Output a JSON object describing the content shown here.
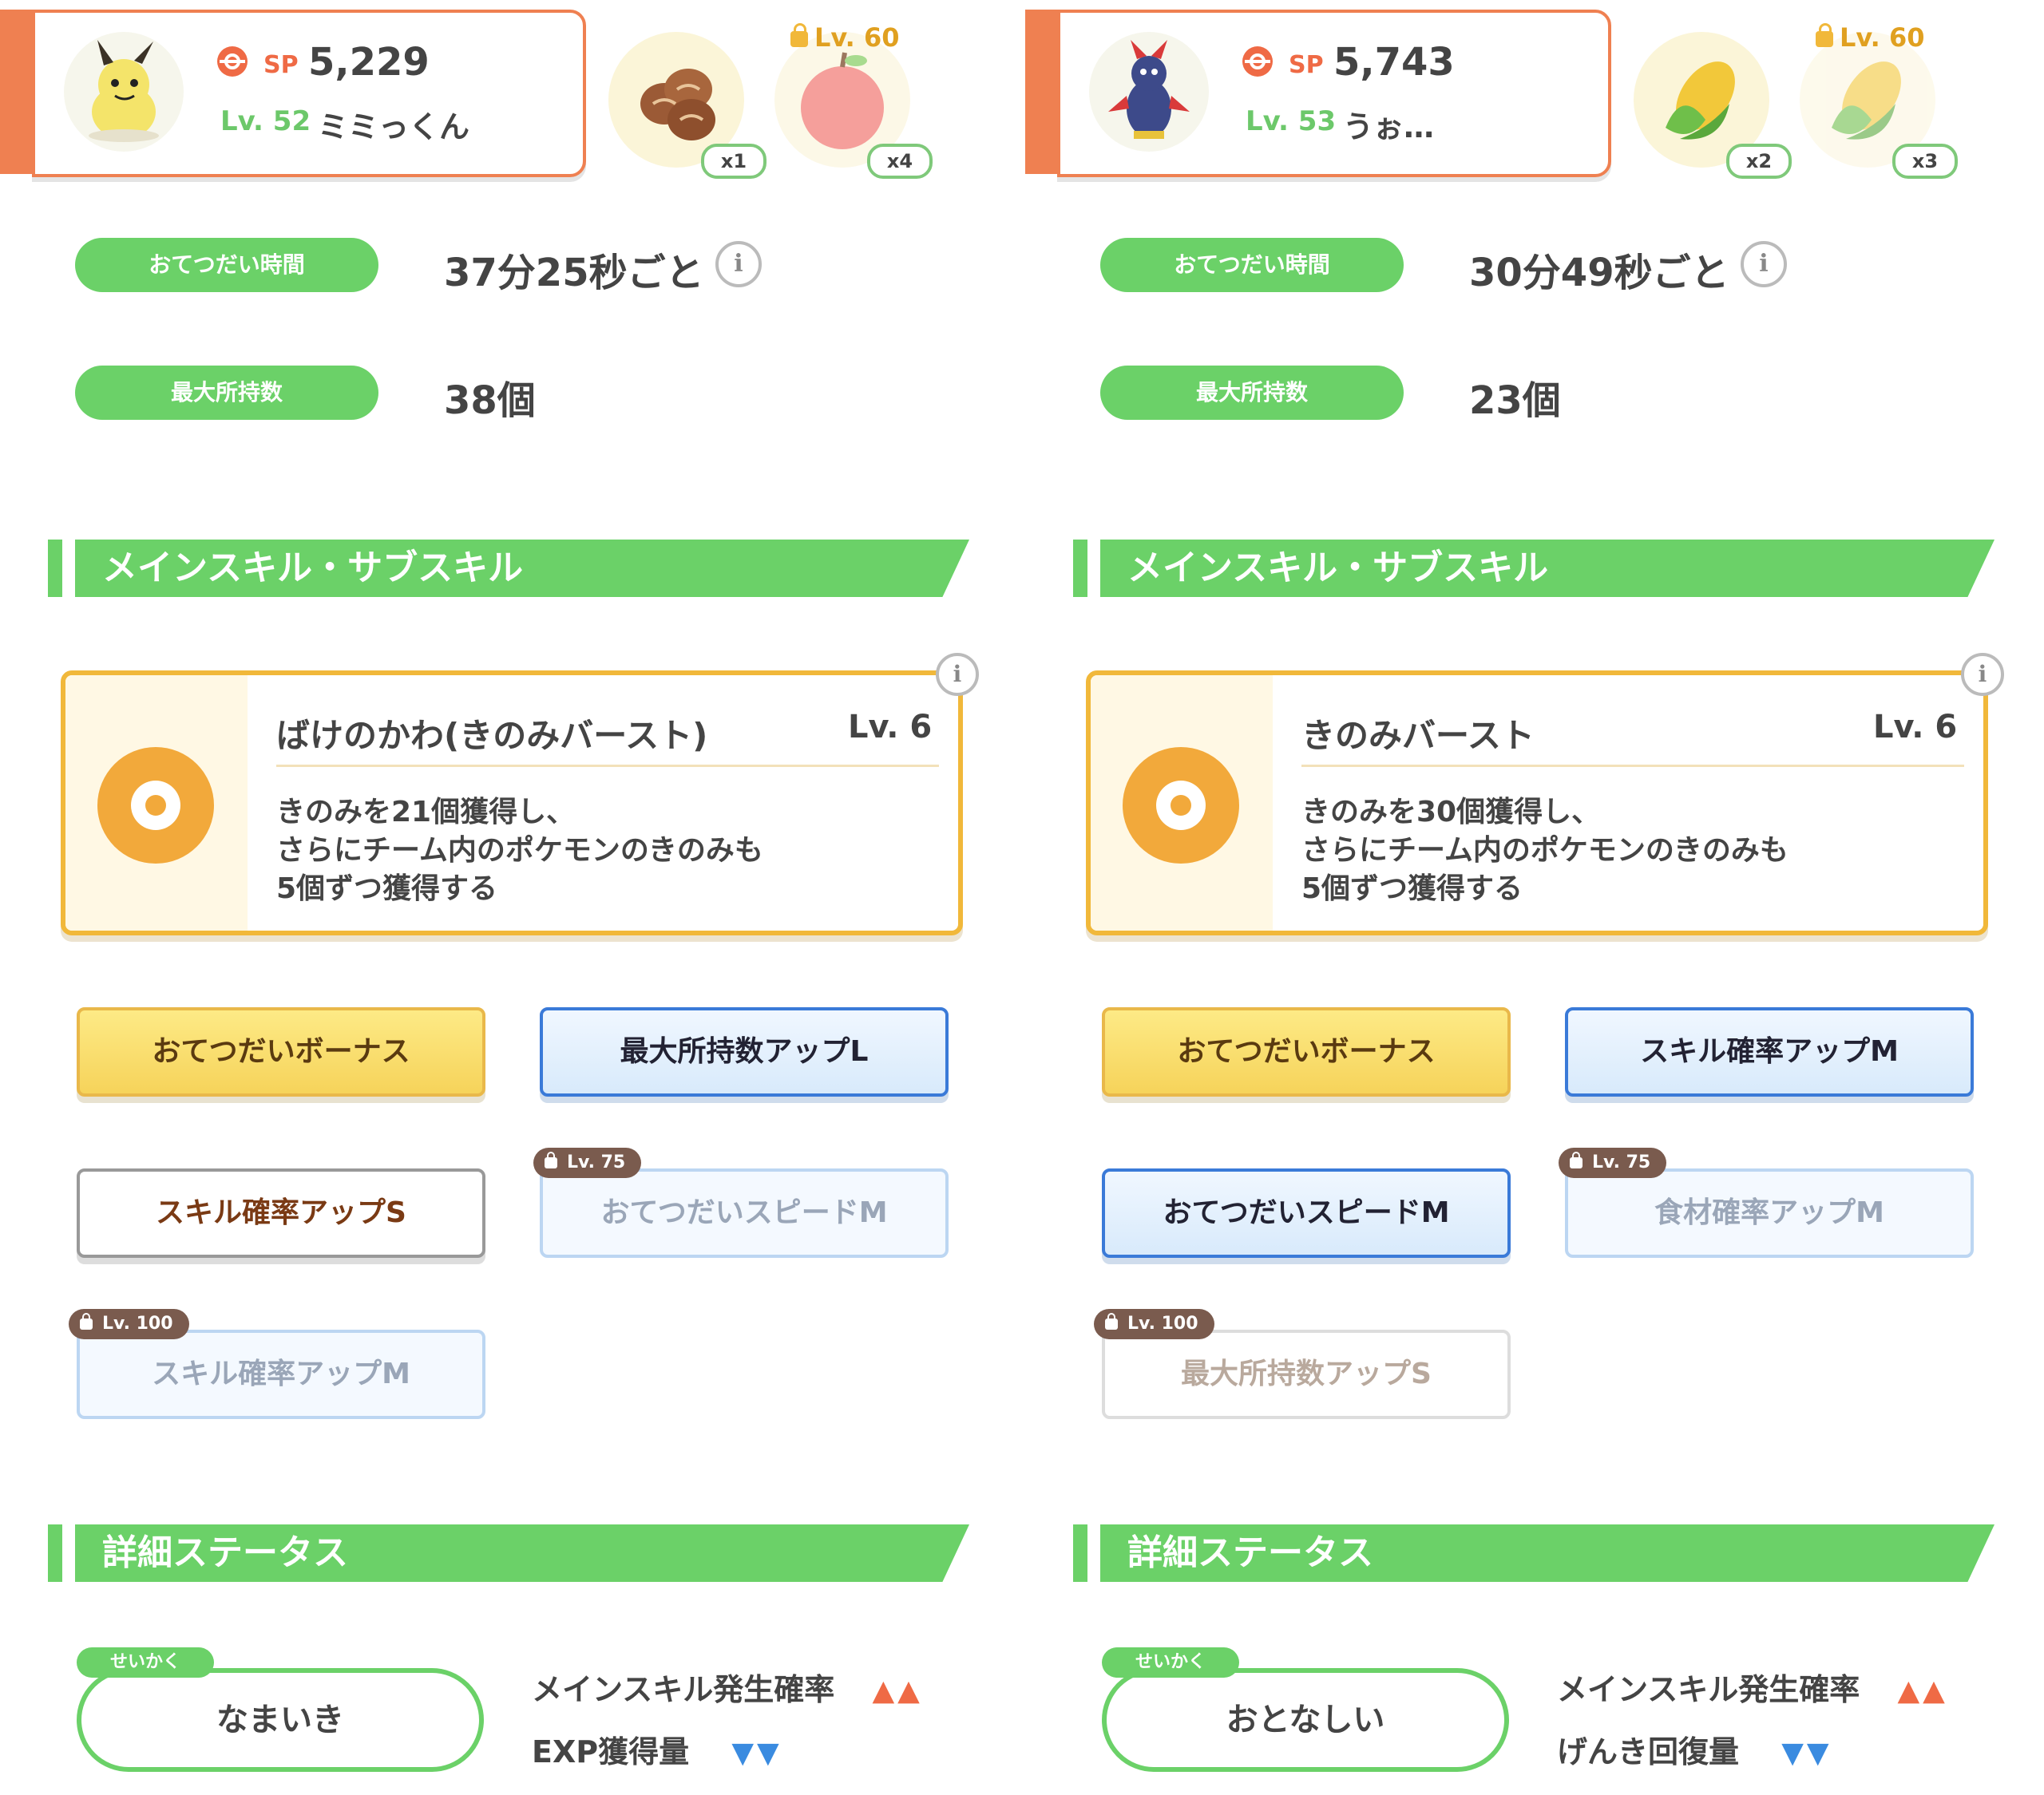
{
  "colors": {
    "green": "#6bd168",
    "orange": "#ef8051",
    "gold": "#f1b83a",
    "blue": "#3a7ad8",
    "up_arrow": "#ef6a45",
    "down_arrow": "#3a8be0"
  },
  "panels": [
    {
      "header": {
        "sp_label": "SP",
        "sp_value": "5,229",
        "level": "Lv. 52",
        "nickname": "ミミっくん",
        "avatar_icon": "mimikyu-avatar-icon"
      },
      "ingredients": [
        {
          "icon": "soybeans-icon",
          "count": "x1",
          "lock": ""
        },
        {
          "icon": "apple-icon",
          "count": "x4",
          "lock": "Lv. 60"
        }
      ],
      "help_time": {
        "label": "おてつだい時間",
        "value": "37分25秒ごと",
        "info": "i"
      },
      "max_carry": {
        "label": "最大所持数",
        "value": "38個"
      },
      "skills_header": "メインスキル・サブスキル",
      "main_skill": {
        "name": "ばけのかわ(きのみバースト)",
        "level": "Lv. 6",
        "description": "きのみを21個獲得し、\nさらにチーム内のポケモンのきのみも\n5個ずつ獲得する",
        "icon": "berry-burst-icon",
        "info": "i"
      },
      "subskills": [
        {
          "label": "おてつだいボーナス",
          "style": "gold",
          "lock": ""
        },
        {
          "label": "最大所持数アップL",
          "style": "blue",
          "lock": ""
        },
        {
          "label": "スキル確率アップS",
          "style": "white",
          "lock": ""
        },
        {
          "label": "おてつだいスピードM",
          "style": "locked-blue",
          "lock": "Lv. 75"
        },
        {
          "label": "スキル確率アップM",
          "style": "locked-blue",
          "lock": "Lv. 100"
        }
      ],
      "details_header": "詳細ステータス",
      "nature": {
        "tag": "せいかく",
        "name": "なまいき",
        "effects": [
          {
            "label": "メインスキル発生確率",
            "arrows": "▲▲",
            "dir": "up"
          },
          {
            "label": "EXP獲得量",
            "arrows": "▼▼",
            "dir": "down"
          }
        ]
      }
    },
    {
      "header": {
        "sp_label": "SP",
        "sp_value": "5,743",
        "level": "Lv. 53",
        "nickname": "うぉ…",
        "avatar_icon": "pawmot-avatar-icon"
      },
      "ingredients": [
        {
          "icon": "corn-icon",
          "count": "x2",
          "lock": ""
        },
        {
          "icon": "corn-icon",
          "count": "x3",
          "lock": "Lv. 60"
        }
      ],
      "help_time": {
        "label": "おてつだい時間",
        "value": "30分49秒ごと",
        "info": "i"
      },
      "max_carry": {
        "label": "最大所持数",
        "value": "23個"
      },
      "skills_header": "メインスキル・サブスキル",
      "main_skill": {
        "name": "きのみバースト",
        "level": "Lv. 6",
        "description": "きのみを30個獲得し、\nさらにチーム内のポケモンのきのみも\n5個ずつ獲得する",
        "icon": "berry-burst-icon",
        "info": "i"
      },
      "subskills": [
        {
          "label": "おてつだいボーナス",
          "style": "gold",
          "lock": ""
        },
        {
          "label": "スキル確率アップM",
          "style": "blue",
          "lock": ""
        },
        {
          "label": "おてつだいスピードM",
          "style": "blue",
          "lock": ""
        },
        {
          "label": "食材確率アップM",
          "style": "locked-blue",
          "lock": "Lv. 75"
        },
        {
          "label": "最大所持数アップS",
          "style": "locked-white",
          "lock": "Lv. 100"
        }
      ],
      "details_header": "詳細ステータス",
      "nature": {
        "tag": "せいかく",
        "name": "おとなしい",
        "effects": [
          {
            "label": "メインスキル発生確率",
            "arrows": "▲▲",
            "dir": "up"
          },
          {
            "label": "げんき回復量",
            "arrows": "▼▼",
            "dir": "down"
          }
        ]
      }
    }
  ]
}
